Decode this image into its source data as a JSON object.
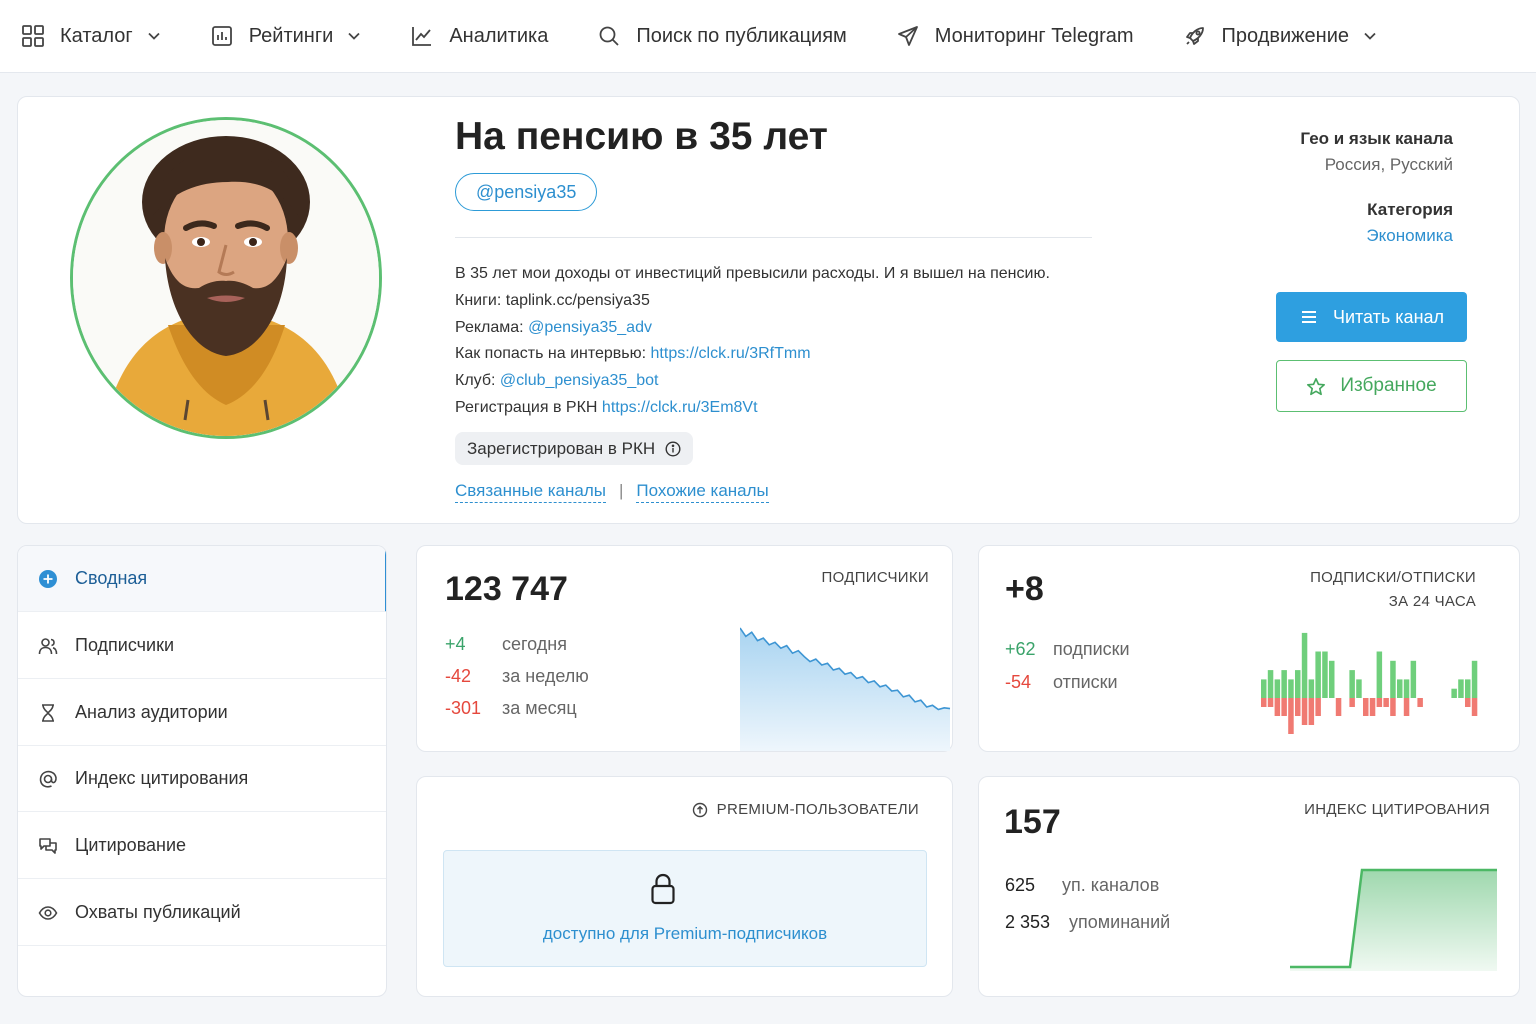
{
  "nav": {
    "items": [
      {
        "label": "Каталог",
        "icon": "grid-icon",
        "dropdown": true
      },
      {
        "label": "Рейтинги",
        "icon": "bar-chart-icon",
        "dropdown": true
      },
      {
        "label": "Аналитика",
        "icon": "line-chart-icon",
        "dropdown": false
      },
      {
        "label": "Поиск по публикациям",
        "icon": "search-icon",
        "dropdown": false
      },
      {
        "label": "Мониторинг Telegram",
        "icon": "paper-plane-icon",
        "dropdown": false
      },
      {
        "label": "Продвижение",
        "icon": "rocket-icon",
        "dropdown": true
      }
    ]
  },
  "channel": {
    "title": "На пенсию в 35 лет",
    "handle": "@pensiya35",
    "description": [
      {
        "text": "В 35 лет мои доходы от инвестиций превысили расходы. И я вышел на пенсию.",
        "link": ""
      },
      {
        "text": "Книги: taplink.cc/pensiya35",
        "link": ""
      },
      {
        "text": "Реклама: ",
        "link": "@pensiya35_adv"
      },
      {
        "text": "Как попасть на интервью: ",
        "link": "https://clck.ru/3RfTmm"
      },
      {
        "text": "Клуб: ",
        "link": "@club_pensiya35_bot"
      },
      {
        "text": "Регистрация в РКН ",
        "link": "https://clck.ru/3Em8Vt"
      }
    ],
    "rkn_badge": "Зарегистрирован в РКН",
    "related_link": "Связанные каналы",
    "separator": "|",
    "similar_link": "Похожие каналы",
    "geo_label": "Гео и язык канала",
    "geo_value": "Россия, Русский",
    "category_label": "Категория",
    "category_value": "Экономика",
    "read_button": "Читать канал",
    "favorite_button": "Избранное"
  },
  "sidebar": {
    "items": [
      {
        "label": "Сводная",
        "icon": "plus-circle-icon",
        "active": true
      },
      {
        "label": "Подписчики",
        "icon": "users-icon",
        "active": false
      },
      {
        "label": "Анализ аудитории",
        "icon": "hourglass-icon",
        "active": false
      },
      {
        "label": "Индекс цитирования",
        "icon": "at-sign-icon",
        "active": false
      },
      {
        "label": "Цитирование",
        "icon": "quote-chat-icon",
        "active": false
      },
      {
        "label": "Охваты публикаций",
        "icon": "eye-icon",
        "active": false
      }
    ]
  },
  "subscribers": {
    "value": "123 747",
    "caption": "ПОДПИСЧИКИ",
    "today_delta": "+4",
    "today_label": "сегодня",
    "week_delta": "-42",
    "week_label": "за неделю",
    "month_delta": "-301",
    "month_label": "за месяц",
    "trend": [
      1.0,
      0.9,
      0.95,
      0.85,
      0.88,
      0.8,
      0.83,
      0.76,
      0.79,
      0.7,
      0.73,
      0.66,
      0.6,
      0.63,
      0.56,
      0.58,
      0.5,
      0.52,
      0.45,
      0.47,
      0.4,
      0.42,
      0.35,
      0.37,
      0.3,
      0.32,
      0.25,
      0.26,
      0.18,
      0.2,
      0.12,
      0.14,
      0.06,
      0.08,
      0.03,
      0.05,
      0.04
    ]
  },
  "subs_unsubs": {
    "value": "+8",
    "caption_line1": "ПОДПИСКИ/ОТПИСКИ",
    "caption_line2": "ЗА 24 ЧАСА",
    "plus_value": "+62",
    "plus_label": "подписки",
    "minus_value": "-54",
    "minus_label": "отписки",
    "bars_up": [
      2,
      3,
      2,
      3,
      2,
      3,
      7,
      2,
      5,
      5,
      4,
      0,
      0,
      3,
      2,
      0,
      0,
      5,
      0,
      4,
      2,
      2,
      4,
      0,
      0,
      0,
      0,
      0,
      1,
      2,
      2,
      4
    ],
    "bars_down": [
      1,
      1,
      2,
      2,
      4,
      2,
      3,
      3,
      2,
      0,
      0,
      2,
      0,
      1,
      0,
      2,
      2,
      1,
      1,
      2,
      0,
      2,
      0,
      1,
      0,
      0,
      0,
      0,
      0,
      0,
      1,
      2
    ]
  },
  "premium": {
    "caption": "PREMIUM-ПОЛЬЗОВАТЕЛИ",
    "locked_text": "доступно для Premium-подписчиков"
  },
  "citation": {
    "value": "157",
    "caption": "ИНДЕКС ЦИТИРОВАНИЯ",
    "channels_value": "625",
    "channels_label": "уп. каналов",
    "mentions_value": "2 353",
    "mentions_label": "упоминаний"
  },
  "colors": {
    "accent": "#2e9fe0",
    "positive": "#3aa36a",
    "negative": "#e5483d",
    "favorite_border": "#5cbf72"
  }
}
